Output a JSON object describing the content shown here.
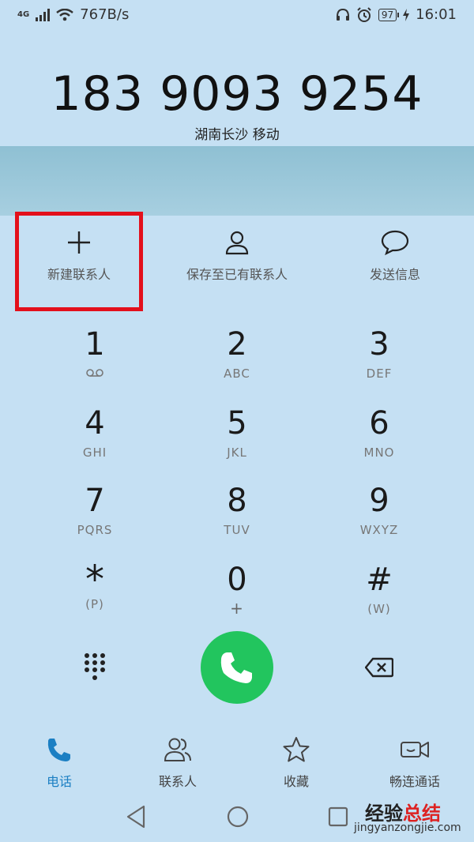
{
  "status": {
    "network": "4G",
    "speed": "767B/s",
    "battery": "97",
    "time": "16:01"
  },
  "dial": {
    "number": "183 9093 9254",
    "location": "湖南长沙 移动"
  },
  "actions": [
    {
      "label": "新建联系人",
      "icon": "plus-icon"
    },
    {
      "label": "保存至已有联系人",
      "icon": "person-icon"
    },
    {
      "label": "发送信息",
      "icon": "message-bubble-icon"
    }
  ],
  "keypad": [
    {
      "digit": "1",
      "sub": ""
    },
    {
      "digit": "2",
      "sub": "ABC"
    },
    {
      "digit": "3",
      "sub": "DEF"
    },
    {
      "digit": "4",
      "sub": "GHI"
    },
    {
      "digit": "5",
      "sub": "JKL"
    },
    {
      "digit": "6",
      "sub": "MNO"
    },
    {
      "digit": "7",
      "sub": "PQRS"
    },
    {
      "digit": "8",
      "sub": "TUV"
    },
    {
      "digit": "9",
      "sub": "WXYZ"
    },
    {
      "digit": "*",
      "sub": "(P)"
    },
    {
      "digit": "0",
      "sub": "+"
    },
    {
      "digit": "#",
      "sub": "(W)"
    }
  ],
  "nav": [
    {
      "label": "电话",
      "icon": "phone-icon",
      "active": true
    },
    {
      "label": "联系人",
      "icon": "contacts-icon",
      "active": false
    },
    {
      "label": "收藏",
      "icon": "star-icon",
      "active": false
    },
    {
      "label": "畅连通话",
      "icon": "video-call-icon",
      "active": false
    }
  ],
  "watermark": {
    "brand_a": "经验",
    "brand_b": "总结",
    "url": "jingyanzongjie.com"
  },
  "colors": {
    "background": "#c5e0f3",
    "call_button": "#22c55e",
    "active_tab": "#1b7fc3",
    "highlight_box": "#e3101b"
  }
}
